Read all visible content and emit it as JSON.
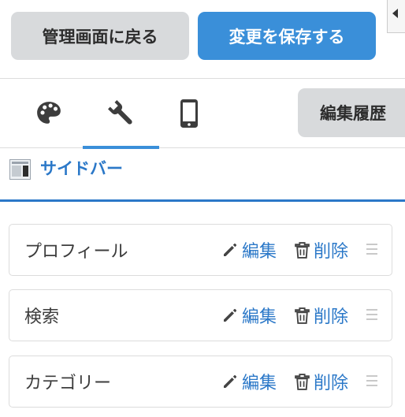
{
  "toolbar": {
    "back_label": "管理画面に戻る",
    "save_label": "変更を保存する"
  },
  "tabs": {
    "items": [
      {
        "name": "style",
        "icon": "palette-icon"
      },
      {
        "name": "tools",
        "icon": "wrench-icon",
        "active": true
      },
      {
        "name": "device",
        "icon": "smartphone-icon"
      }
    ],
    "history_label": "編集履歴"
  },
  "section": {
    "title": "サイドバー",
    "icon": "sidebar-layout-icon"
  },
  "widgets": [
    {
      "label": "プロフィール",
      "edit_label": "編集",
      "delete_label": "削除"
    },
    {
      "label": "検索",
      "edit_label": "編集",
      "delete_label": "削除"
    },
    {
      "label": "カテゴリー",
      "edit_label": "編集",
      "delete_label": "削除"
    }
  ],
  "colors": {
    "accent": "#3a8fd9",
    "link": "#2b78c8",
    "neutral_button": "#d8dadc"
  }
}
